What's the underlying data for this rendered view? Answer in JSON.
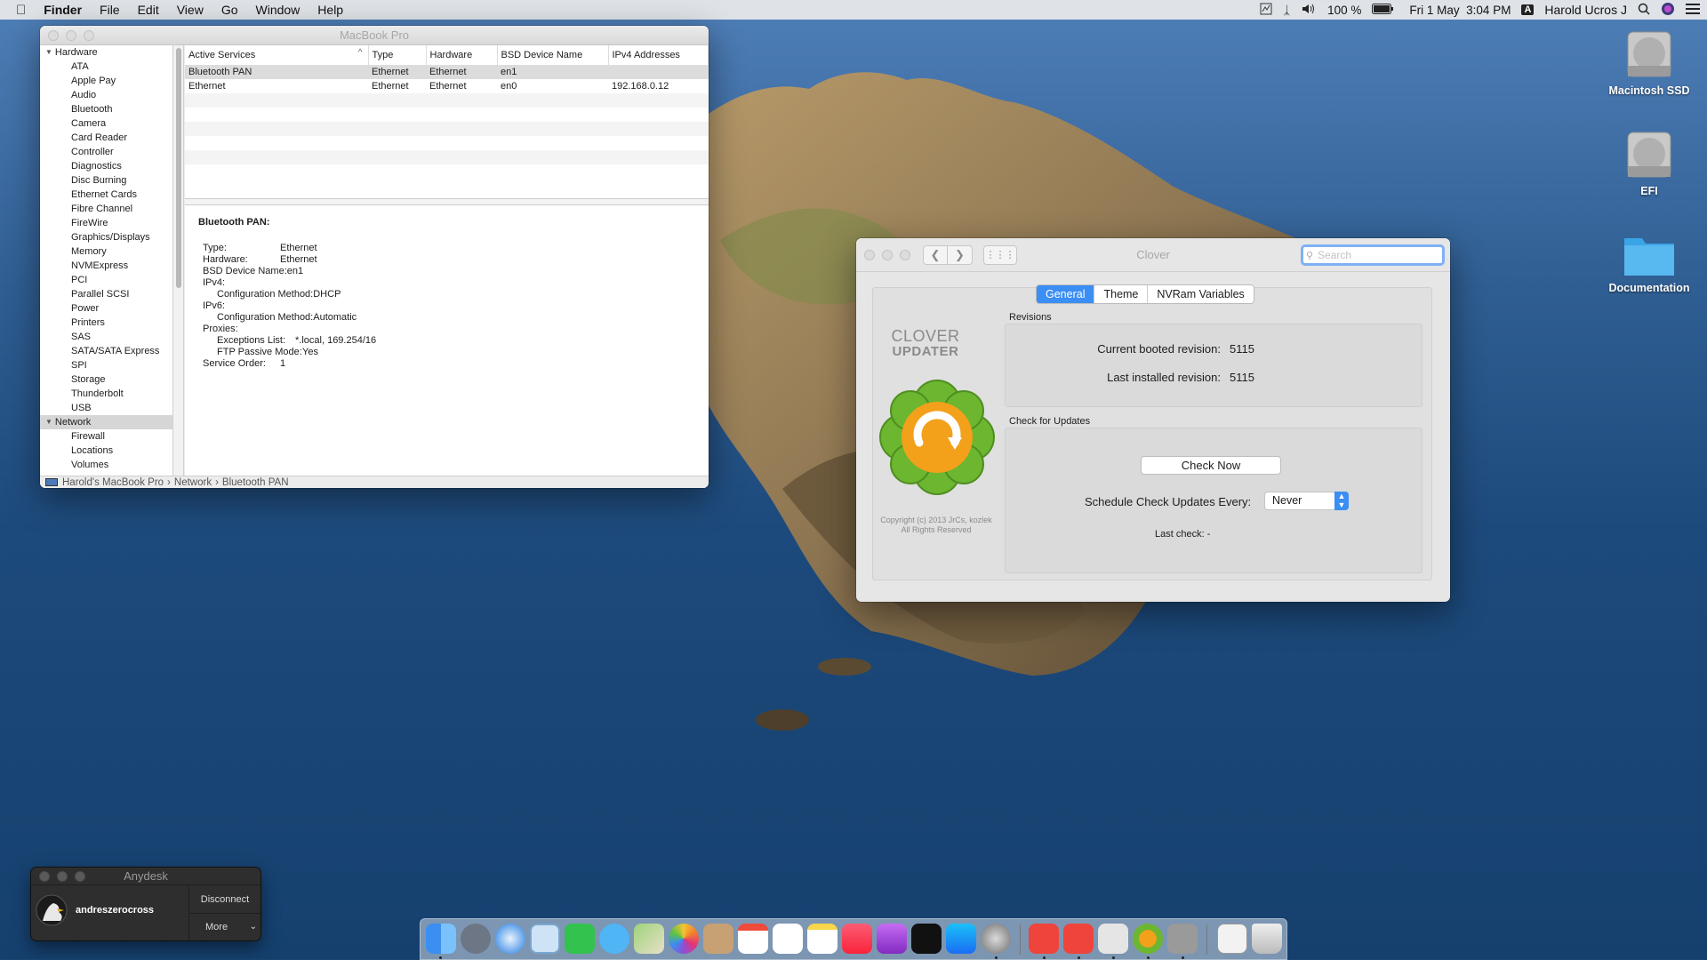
{
  "menubar": {
    "apple": "",
    "app": "Finder",
    "items": [
      "File",
      "Edit",
      "View",
      "Go",
      "Window",
      "Help"
    ],
    "battery": "100 %",
    "datetime": "Fri 1 May  3:04 PM",
    "input_badge": "A",
    "user": "Harold Ucros J"
  },
  "desktop": {
    "icons": [
      {
        "label": "Macintosh SSD"
      },
      {
        "label": "EFI"
      },
      {
        "label": "Documentation"
      }
    ]
  },
  "sysinfo": {
    "title": "MacBook Pro",
    "sidebar": {
      "hardware_label": "Hardware",
      "hardware_items": [
        "ATA",
        "Apple Pay",
        "Audio",
        "Bluetooth",
        "Camera",
        "Card Reader",
        "Controller",
        "Diagnostics",
        "Disc Burning",
        "Ethernet Cards",
        "Fibre Channel",
        "FireWire",
        "Graphics/Displays",
        "Memory",
        "NVMExpress",
        "PCI",
        "Parallel SCSI",
        "Power",
        "Printers",
        "SAS",
        "SATA/SATA Express",
        "SPI",
        "Storage",
        "Thunderbolt",
        "USB"
      ],
      "network_label": "Network",
      "network_items": [
        "Firewall",
        "Locations",
        "Volumes"
      ]
    },
    "table": {
      "headers": [
        "Active Services",
        "Type",
        "Hardware",
        "BSD Device Name",
        "IPv4 Addresses"
      ],
      "sort_arrow": "^",
      "rows": [
        [
          "Bluetooth PAN",
          "Ethernet",
          "Ethernet",
          "en1",
          ""
        ],
        [
          "Ethernet",
          "Ethernet",
          "Ethernet",
          "en0",
          "192.168.0.12"
        ]
      ]
    },
    "detail": {
      "heading": "Bluetooth PAN:",
      "rows": [
        {
          "k": "Type:",
          "v": "Ethernet",
          "indent": 0
        },
        {
          "k": "Hardware:",
          "v": "Ethernet",
          "indent": 0
        },
        {
          "k": "BSD Device Name:",
          "v": "en1",
          "indent": 0
        },
        {
          "k": "IPv4:",
          "v": "",
          "indent": 0
        },
        {
          "k": "Configuration Method:",
          "v": "DHCP",
          "indent": 1
        },
        {
          "k": "IPv6:",
          "v": "",
          "indent": 0
        },
        {
          "k": "Configuration Method:",
          "v": "Automatic",
          "indent": 1
        },
        {
          "k": "Proxies:",
          "v": "",
          "indent": 0
        },
        {
          "k": "Exceptions List:",
          "v": "*.local, 169.254/16",
          "indent": 1
        },
        {
          "k": "FTP Passive Mode:",
          "v": "Yes",
          "indent": 1
        },
        {
          "k": "Service Order:",
          "v": "1",
          "indent": 0
        }
      ]
    },
    "pathbar": {
      "items": [
        "Harold's MacBook Pro",
        "Network",
        "Bluetooth PAN"
      ],
      "separator": "›"
    }
  },
  "clover": {
    "title": "Clover",
    "search_placeholder": "Search",
    "tabs": [
      "General",
      "Theme",
      "NVRam Variables"
    ],
    "logo_line1": "CLOVER",
    "logo_line2": "UPDATER",
    "copyright": "Copyright (c) 2013 JrCs, kozlek\nAll Rights Reserved",
    "revisions": {
      "label": "Revisions",
      "current_label": "Current booted revision:",
      "current_value": "5115",
      "last_label": "Last installed revision:",
      "last_value": "5115"
    },
    "updates": {
      "label": "Check for Updates",
      "check_now": "Check Now",
      "schedule_label": "Schedule Check Updates Every:",
      "schedule_value": "Never",
      "last_check": "Last check: -"
    }
  },
  "anydesk": {
    "title": "Anydesk",
    "user": "andreszerocross",
    "disconnect": "Disconnect",
    "more": "More"
  },
  "colors": {
    "accent": "#3b8ef3",
    "clover_green": "#6cb630",
    "clover_orange": "#f3a01b"
  }
}
